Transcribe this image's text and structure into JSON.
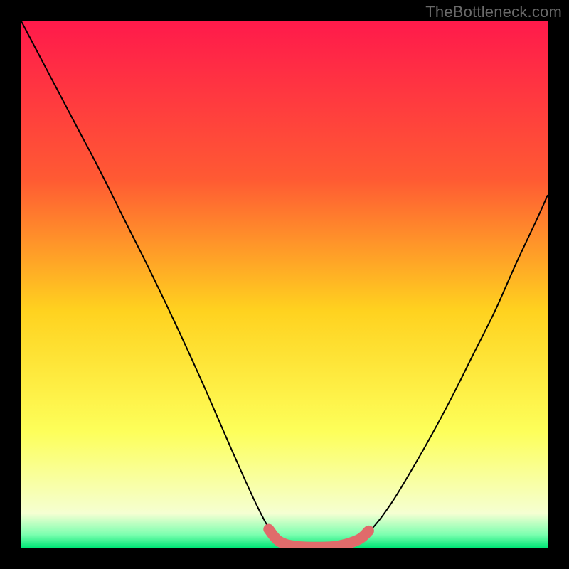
{
  "watermark": "TheBottleneck.com",
  "chart_data": {
    "type": "line",
    "title": "",
    "xlabel": "",
    "ylabel": "",
    "xlim": [
      0,
      1
    ],
    "ylim": [
      0,
      1
    ],
    "background_gradient": {
      "stops": [
        {
          "offset": 0.0,
          "color": "#ff1a4b"
        },
        {
          "offset": 0.3,
          "color": "#ff5a33"
        },
        {
          "offset": 0.55,
          "color": "#ffd21f"
        },
        {
          "offset": 0.78,
          "color": "#fdff5a"
        },
        {
          "offset": 0.935,
          "color": "#f5ffd2"
        },
        {
          "offset": 0.975,
          "color": "#7dffb0"
        },
        {
          "offset": 1.0,
          "color": "#00e676"
        }
      ]
    },
    "series": [
      {
        "name": "bottleneck-curve",
        "stroke": "#000000",
        "stroke_width": 2,
        "x": [
          0.0,
          0.05,
          0.1,
          0.15,
          0.2,
          0.25,
          0.3,
          0.35,
          0.4,
          0.45,
          0.48,
          0.51,
          0.54,
          0.58,
          0.62,
          0.66,
          0.7,
          0.74,
          0.78,
          0.82,
          0.86,
          0.9,
          0.94,
          0.98,
          1.0
        ],
        "y": [
          1.0,
          0.905,
          0.81,
          0.715,
          0.615,
          0.515,
          0.41,
          0.3,
          0.185,
          0.075,
          0.025,
          0.006,
          0.0,
          0.0,
          0.005,
          0.03,
          0.08,
          0.145,
          0.215,
          0.29,
          0.37,
          0.45,
          0.54,
          0.625,
          0.67
        ]
      },
      {
        "name": "trough-highlight",
        "stroke": "#e06b6b",
        "stroke_width": 15,
        "linecap": "round",
        "x": [
          0.47,
          0.49,
          0.52,
          0.56,
          0.6,
          0.64,
          0.66
        ],
        "y": [
          0.035,
          0.012,
          0.003,
          0.001,
          0.003,
          0.015,
          0.032
        ]
      }
    ]
  }
}
